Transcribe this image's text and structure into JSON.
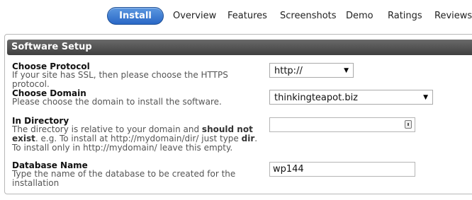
{
  "tabs": {
    "install": "Install",
    "overview": "Overview",
    "features": "Features",
    "screenshots": "Screenshots",
    "demo": "Demo",
    "ratings": "Ratings",
    "reviews": "Reviews"
  },
  "panel": {
    "title": "Software Setup"
  },
  "fields": {
    "protocol": {
      "label": "Choose Protocol",
      "desc": "If your site has SSL, then please choose the HTTPS protocol.",
      "value": "http://"
    },
    "domain": {
      "label": "Choose Domain",
      "desc": "Please choose the domain to install the software.",
      "value": "thinkingteapot.biz"
    },
    "directory": {
      "label": "In Directory",
      "desc_1": "The directory is relative to your domain and ",
      "desc_2": "should not exist",
      "desc_3": ". e.g. To install at http://mydomain/dir/ just type ",
      "desc_4": "dir",
      "desc_5": ". To install only in http://mydomain/ leave this empty.",
      "value": ""
    },
    "database": {
      "label": "Database Name",
      "desc": "Type the name of the database to be created for the installation",
      "value": "wp144"
    }
  },
  "icons": {
    "select_arrow": "▼",
    "directory_field_icon": "lock-icon"
  }
}
